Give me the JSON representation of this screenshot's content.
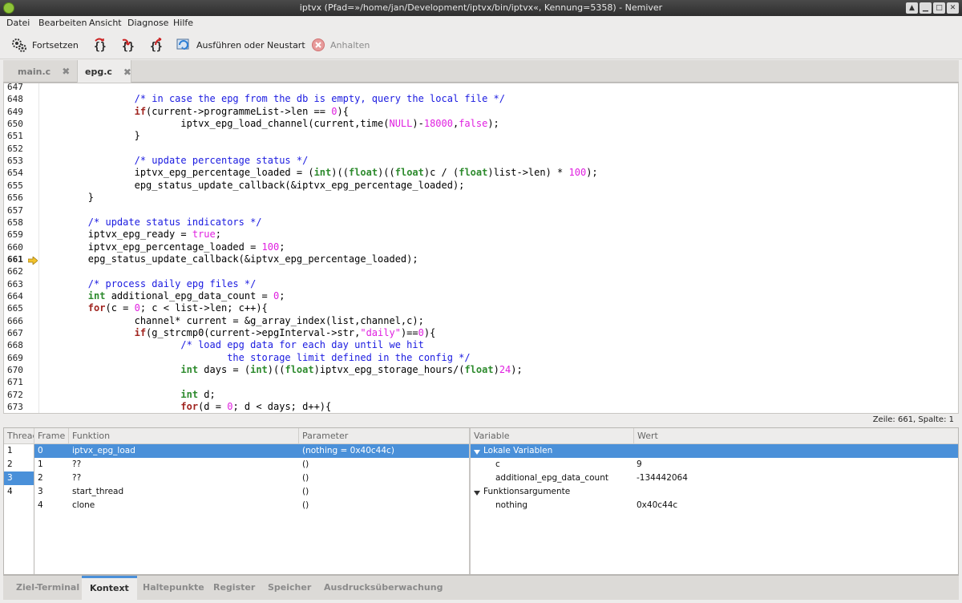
{
  "window": {
    "title": "iptvx (Pfad=»/home/jan/Development/iptvx/bin/iptvx«, Kennung=5358) - Nemiver"
  },
  "menu": [
    "Datei",
    "Bearbeiten",
    "Ansicht",
    "Diagnose",
    "Hilfe"
  ],
  "toolbar": {
    "continue_label": "Fortsetzen",
    "run_label": "Ausführen oder Neustart",
    "stop_label": "Anhalten"
  },
  "tabs": [
    {
      "label": "main.c",
      "close": "✖"
    },
    {
      "label": "epg.c",
      "close": "✖"
    }
  ],
  "editor": {
    "lines": [
      {
        "n": "647",
        "html": ""
      },
      {
        "n": "648",
        "html": "                <span class=\"cm\">/* in case the epg from the db is empty, query the local file */</span>"
      },
      {
        "n": "649",
        "html": "                <span class=\"kw\">if</span>(current-&gt;programmeList-&gt;len == <span class=\"nu\">0</span>){"
      },
      {
        "n": "650",
        "html": "                        iptvx_epg_load_channel(current,time(<span class=\"nu\">NULL</span>)-<span class=\"nu\">18000</span>,<span class=\"nu\">false</span>);"
      },
      {
        "n": "651",
        "html": "                }"
      },
      {
        "n": "652",
        "html": ""
      },
      {
        "n": "653",
        "html": "                <span class=\"cm\">/* update percentage status */</span>"
      },
      {
        "n": "654",
        "html": "                iptvx_epg_percentage_loaded = (<span class=\"ty\">int</span>)((<span class=\"ty\">float</span>)((<span class=\"ty\">float</span>)c / (<span class=\"ty\">float</span>)list-&gt;len) * <span class=\"nu\">100</span>);"
      },
      {
        "n": "655",
        "html": "                epg_status_update_callback(&amp;iptvx_epg_percentage_loaded);"
      },
      {
        "n": "656",
        "html": "        }"
      },
      {
        "n": "657",
        "html": ""
      },
      {
        "n": "658",
        "html": "        <span class=\"cm\">/* update status indicators */</span>"
      },
      {
        "n": "659",
        "html": "        iptvx_epg_ready = <span class=\"nu\">true</span>;"
      },
      {
        "n": "660",
        "html": "        iptvx_epg_percentage_loaded = <span class=\"nu\">100</span>;"
      },
      {
        "n": "661",
        "html": "        epg_status_update_callback(&amp;iptvx_epg_percentage_loaded);"
      },
      {
        "n": "662",
        "html": ""
      },
      {
        "n": "663",
        "html": "        <span class=\"cm\">/* process daily epg files */</span>"
      },
      {
        "n": "664",
        "html": "        <span class=\"ty\">int</span> additional_epg_data_count = <span class=\"nu\">0</span>;"
      },
      {
        "n": "665",
        "html": "        <span class=\"kw\">for</span>(c = <span class=\"nu\">0</span>; c &lt; list-&gt;len; c++){"
      },
      {
        "n": "666",
        "html": "                channel* current = &amp;g_array_index(list,channel,c);"
      },
      {
        "n": "667",
        "html": "                <span class=\"kw\">if</span>(g_strcmp0(current-&gt;epgInterval-&gt;str,<span class=\"nu\">\"daily\"</span>)==<span class=\"nu\">0</span>){"
      },
      {
        "n": "668",
        "html": "                        <span class=\"cm\">/* load epg data for each day until we hit</span>"
      },
      {
        "n": "669",
        "html": "<span class=\"cm\">                                the storage limit defined in the config */</span>"
      },
      {
        "n": "670",
        "html": "                        <span class=\"ty\">int</span> days = (<span class=\"ty\">int</span>)((<span class=\"ty\">float</span>)iptvx_epg_storage_hours/(<span class=\"ty\">float</span>)<span class=\"nu\">24</span>);"
      },
      {
        "n": "671",
        "html": ""
      },
      {
        "n": "672",
        "html": "                        <span class=\"ty\">int</span> d;"
      },
      {
        "n": "673",
        "html": "                        <span class=\"kw\">for</span>(d = <span class=\"nu\">0</span>; d &lt; days; d++){"
      }
    ],
    "current_line": "661"
  },
  "status": {
    "position": "Zeile: 661, Spalte: 1"
  },
  "threads": {
    "header": "Thread",
    "items": [
      "1",
      "2",
      "3",
      "4"
    ],
    "selected": 2
  },
  "frames": {
    "headers": {
      "frame": "Frame",
      "function": "Funktion",
      "params": "Parameter"
    },
    "rows": [
      {
        "frame": "0",
        "function": "iptvx_epg_load",
        "params": "(nothing = 0x40c44c)"
      },
      {
        "frame": "1",
        "function": "??",
        "params": "()"
      },
      {
        "frame": "2",
        "function": "??",
        "params": "()"
      },
      {
        "frame": "3",
        "function": "start_thread",
        "params": "()"
      },
      {
        "frame": "4",
        "function": "clone",
        "params": "()"
      }
    ]
  },
  "vars": {
    "headers": {
      "variable": "Variable",
      "value": "Wert"
    },
    "local_label": "Lokale Variablen",
    "locals": [
      {
        "name": "c",
        "value": "9"
      },
      {
        "name": "additional_epg_data_count",
        "value": "-134442064"
      }
    ],
    "args_label": "Funktionsargumente",
    "args": [
      {
        "name": "nothing",
        "value": "0x40c44c"
      }
    ]
  },
  "bottom_tabs": [
    "Ziel-Terminal",
    "Kontext",
    "Haltepunkte",
    "Register",
    "Speicher",
    "Ausdrucksüberwachung"
  ]
}
